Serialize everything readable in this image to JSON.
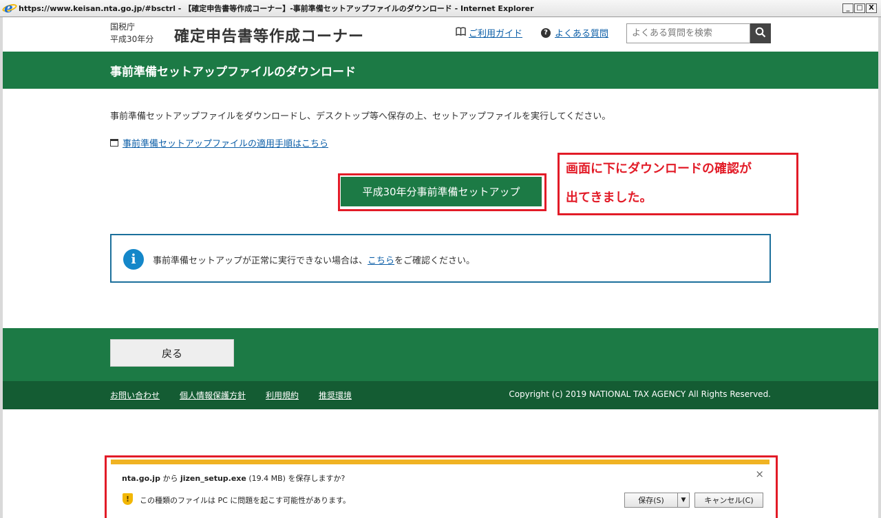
{
  "window": {
    "title": "https://www.keisan.nta.go.jp/#bsctrl - 【確定申告書等作成コーナー】-事前準備セットアップファイルのダウンロード - Internet Explorer",
    "minimize": "_",
    "maximize": "□",
    "close": "X"
  },
  "header": {
    "agency_line1": "国税庁",
    "agency_line2": "平成30年分",
    "site_title": "確定申告書等作成コーナー",
    "guide_icon": "book-icon",
    "guide_link": "ご利用ガイド",
    "faq_icon": "question-icon",
    "faq_link": "よくある質問",
    "search_placeholder": "よくある質問を検索",
    "search_icon": "search-icon"
  },
  "page": {
    "heading": "事前準備セットアップファイルのダウンロード",
    "instruction": "事前準備セットアップファイルをダウンロードし、デスクトップ等へ保存の上、セットアップファイルを実行してください。",
    "procedure_link": "事前準備セットアップファイルの適用手順はこちら",
    "setup_button": "平成30年分事前準備セットアップ"
  },
  "annotation": {
    "line1": "画面に下にダウンロードの確認が",
    "line2": "出てきました。",
    "color": "#e21b27"
  },
  "info": {
    "icon": "info-icon",
    "text_before": "事前準備セットアップが正常に実行できない場合は、",
    "link": "こちら",
    "text_after": "をご確認ください。"
  },
  "footer": {
    "back_button": "戻る",
    "links": [
      "お問い合わせ",
      "個人情報保護方針",
      "利用規約",
      "推奨環境"
    ],
    "copyright": "Copyright (c) 2019 NATIONAL TAX AGENCY All Rights Reserved."
  },
  "download_bar": {
    "site": "nta.go.jp",
    "from": " から ",
    "filename": "jizen_setup.exe",
    "size": " (19.4 MB) ",
    "question": "を保存しますか?",
    "warning": "この種類のファイルは PC に問題を起こす可能性があります。",
    "save_button": "保存(S)",
    "cancel_button": "キャンセル(C)",
    "close": "×"
  },
  "colors": {
    "brand_green": "#1c7a45",
    "footer_green_dark": "#145c33",
    "link_blue": "#0d5fa8",
    "info_border": "#1b6f9b",
    "download_bar_accent": "#f0b323"
  }
}
